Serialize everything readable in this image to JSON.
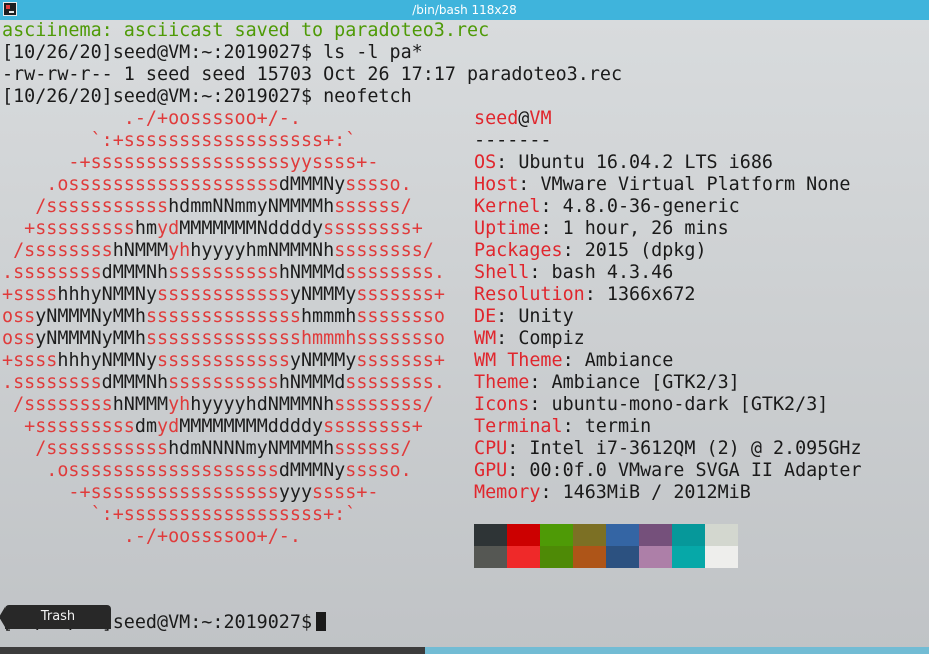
{
  "window": {
    "title": "/bin/bash 118x28"
  },
  "terminal": {
    "lines": [
      "asciinema: asciicast saved to paradoteo3.rec",
      "[10/26/20]seed@VM:~:2019027$ ls -l pa*",
      "-rw-rw-r-- 1 seed seed 15703 Oct 26 17:17 paradoteo3.rec",
      "[10/26/20]seed@VM:~:2019027$ neofetch"
    ],
    "logo": [
      [
        {
          "t": "           .-/+oossssoo+/-.",
          "w": 0
        }
      ],
      [
        {
          "t": "        `:+ssssssssssssssssss+:`",
          "w": 0
        }
      ],
      [
        {
          "t": "      -+ssssssssssssssssssyyssss+-",
          "w": 0
        }
      ],
      [
        {
          "t": "    .osssssssssssssssssss",
          "w": 0
        },
        {
          "t": "dMMMNy",
          "w": 1
        },
        {
          "t": "sssso.",
          "w": 0
        }
      ],
      [
        {
          "t": "   /sssssssssss",
          "w": 0
        },
        {
          "t": "hdmmNNmmyNMMMMh",
          "w": 1
        },
        {
          "t": "ssssss/",
          "w": 0
        }
      ],
      [
        {
          "t": "  +sssssssss",
          "w": 0
        },
        {
          "t": "hm",
          "w": 1
        },
        {
          "t": "yd",
          "w": 0
        },
        {
          "t": "MMMMMMMNddddy",
          "w": 1
        },
        {
          "t": "ssssssss+",
          "w": 0
        }
      ],
      [
        {
          "t": " /ssssssss",
          "w": 0
        },
        {
          "t": "hNMMM",
          "w": 1
        },
        {
          "t": "yh",
          "w": 0
        },
        {
          "t": "hyyyyhmNMMMNh",
          "w": 1
        },
        {
          "t": "ssssssss/",
          "w": 0
        }
      ],
      [
        {
          "t": ".ssssssss",
          "w": 0
        },
        {
          "t": "dMMMNh",
          "w": 1
        },
        {
          "t": "ssssssssss",
          "w": 0
        },
        {
          "t": "hNMMMd",
          "w": 1
        },
        {
          "t": "ssssssss.",
          "w": 0
        }
      ],
      [
        {
          "t": "+ssss",
          "w": 0
        },
        {
          "t": "hhhyNMMNy",
          "w": 1
        },
        {
          "t": "ssssssssssss",
          "w": 0
        },
        {
          "t": "yNMMMy",
          "w": 1
        },
        {
          "t": "sssssss+",
          "w": 0
        }
      ],
      [
        {
          "t": "oss",
          "w": 0
        },
        {
          "t": "yNMMMNyMMh",
          "w": 1
        },
        {
          "t": "ssssssssssssss",
          "w": 0
        },
        {
          "t": "hmmmh",
          "w": 1
        },
        {
          "t": "ssssssso",
          "w": 0
        }
      ],
      [
        {
          "t": "oss",
          "w": 0
        },
        {
          "t": "yNMMMNyMMh",
          "w": 1
        },
        {
          "t": "sssssssssssssshmmmhssssssso",
          "w": 0
        }
      ],
      [
        {
          "t": "+ssss",
          "w": 0
        },
        {
          "t": "hhhyNMMNy",
          "w": 1
        },
        {
          "t": "ssssssssssss",
          "w": 0
        },
        {
          "t": "yNMMMy",
          "w": 1
        },
        {
          "t": "sssssss+",
          "w": 0
        }
      ],
      [
        {
          "t": ".ssssssss",
          "w": 0
        },
        {
          "t": "dMMMNh",
          "w": 1
        },
        {
          "t": "ssssssssss",
          "w": 0
        },
        {
          "t": "hNMMMd",
          "w": 1
        },
        {
          "t": "ssssssss.",
          "w": 0
        }
      ],
      [
        {
          "t": " /ssssssss",
          "w": 0
        },
        {
          "t": "hNMMM",
          "w": 1
        },
        {
          "t": "yh",
          "w": 0
        },
        {
          "t": "hyyyyhdNMMMNh",
          "w": 1
        },
        {
          "t": "ssssssss/",
          "w": 0
        }
      ],
      [
        {
          "t": "  +sssssssss",
          "w": 0
        },
        {
          "t": "dm",
          "w": 1
        },
        {
          "t": "yd",
          "w": 0
        },
        {
          "t": "MMMMMMMMddddy",
          "w": 1
        },
        {
          "t": "ssssssss+",
          "w": 0
        }
      ],
      [
        {
          "t": "   /sssssssssss",
          "w": 0
        },
        {
          "t": "hdmNNNNmyNMMMMh",
          "w": 1
        },
        {
          "t": "ssssss/",
          "w": 0
        }
      ],
      [
        {
          "t": "    .osssssssssssssssssss",
          "w": 0
        },
        {
          "t": "dMMMNy",
          "w": 1
        },
        {
          "t": "sssso.",
          "w": 0
        }
      ],
      [
        {
          "t": "      -+sssssssssssssssss",
          "w": 0
        },
        {
          "t": "yyy",
          "w": 1
        },
        {
          "t": "ssss+-",
          "w": 0
        }
      ],
      [
        {
          "t": "        `:+ssssssssssssssssss+:`",
          "w": 0
        }
      ],
      [
        {
          "t": "           .-/+oossssoo+/-.",
          "w": 0
        }
      ]
    ],
    "user": "seed",
    "at": "@",
    "host": "VM",
    "separator": "-------",
    "info": [
      {
        "key": "OS",
        "value": "Ubuntu 16.04.2 LTS i686"
      },
      {
        "key": "Host",
        "value": "VMware Virtual Platform None"
      },
      {
        "key": "Kernel",
        "value": "4.8.0-36-generic"
      },
      {
        "key": "Uptime",
        "value": "1 hour, 26 mins"
      },
      {
        "key": "Packages",
        "value": "2015 (dpkg)"
      },
      {
        "key": "Shell",
        "value": "bash 4.3.46"
      },
      {
        "key": "Resolution",
        "value": "1366x672"
      },
      {
        "key": "DE",
        "value": "Unity"
      },
      {
        "key": "WM",
        "value": "Compiz"
      },
      {
        "key": "WM Theme",
        "value": "Ambiance"
      },
      {
        "key": "Theme",
        "value": "Ambiance [GTK2/3]"
      },
      {
        "key": "Icons",
        "value": "ubuntu-mono-dark [GTK2/3]"
      },
      {
        "key": "Terminal",
        "value": "termin"
      },
      {
        "key": "CPU",
        "value": "Intel i7-3612QM (2) @ 2.095GHz"
      },
      {
        "key": "GPU",
        "value": "00:0f.0 VMware SVGA II Adapter"
      },
      {
        "key": "Memory",
        "value": "1463MiB / 2012MiB"
      }
    ],
    "palette": [
      [
        "#2e3436",
        "#cc0000",
        "#4e9a06",
        "#7c7024",
        "#3465a4",
        "#75507b",
        "#06989a",
        "#d3d7cf"
      ],
      [
        "#555753",
        "#ef2929",
        "#4e8a06",
        "#ae5518",
        "#2c5180",
        "#ad7fa8",
        "#06a8a8",
        "#eeeeec"
      ]
    ],
    "prompt": "[10/26/20]seed@VM:~:2019027$"
  },
  "dock": {
    "tooltip": "Trash"
  },
  "colors": {
    "titlebar": "#3fb4dc",
    "logo_red": "#e03b3b",
    "key_red": "#e0262d",
    "green": "#4e9a06",
    "text": "#1a1a1a"
  }
}
